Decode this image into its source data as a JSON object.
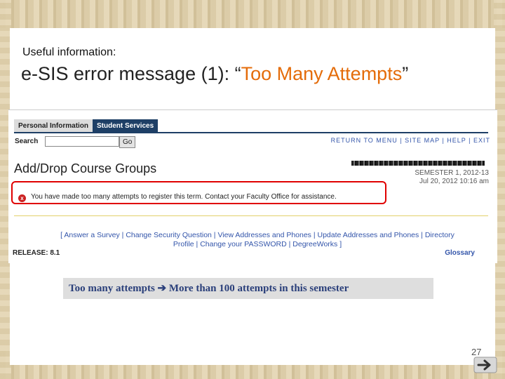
{
  "slide": {
    "kicker": "Useful information:",
    "title_prefix": "e-SIS error message (1): “",
    "title_highlight": "Too Many Attempts",
    "title_suffix": "”",
    "caption_left": "Too many attempts",
    "caption_arrow": "➔",
    "caption_right": "More than 100 attempts in this semester",
    "page_number": "27"
  },
  "screenshot": {
    "tabs": [
      "Personal Information",
      "Student Services"
    ],
    "search_label": "Search",
    "search_value": "",
    "go_label": "Go",
    "top_links": "RETURN TO MENU | SITE MAP | HELP | EXIT",
    "page_heading": "Add/Drop Course Groups",
    "term_line1": "SEMESTER 1, 2012-13",
    "term_line2": "Jul 20, 2012 10:16 am",
    "error_message": "You have made too many attempts to register this term. Contact your Faculty Office for assistance.",
    "footer_links_line1": "[ Answer a Survey | Change Security Question | View Addresses and Phones | Update Addresses and Phones | Directory",
    "footer_links_line2": "Profile | Change your PASSWORD | DegreeWorks ]",
    "release": "RELEASE: 8.1",
    "glossary": "Glossary"
  },
  "colors": {
    "highlight": "#e46c0a",
    "tab_active": "#1e3f66",
    "error_border": "#e00000",
    "caption_text": "#2a3f7a"
  },
  "icons": [
    "error-icon",
    "arrow-right-icon",
    "next-slide-icon"
  ]
}
